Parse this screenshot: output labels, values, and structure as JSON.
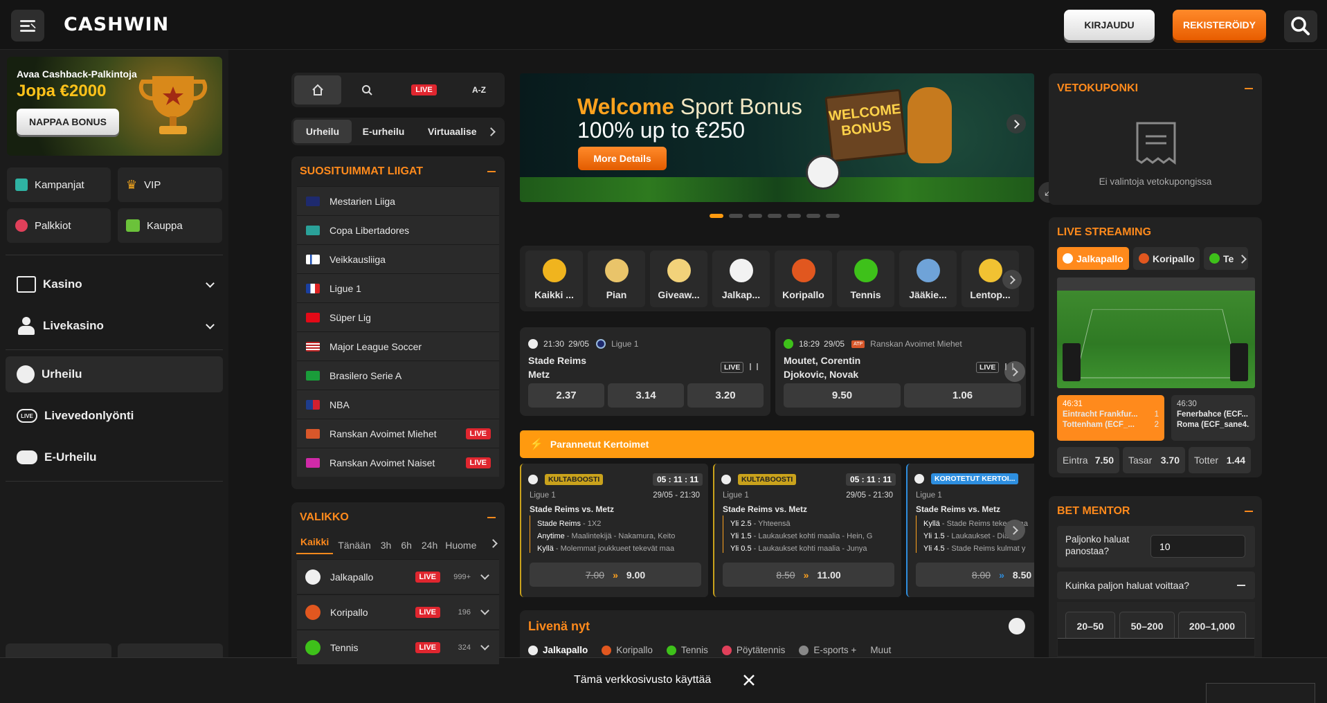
{
  "header": {
    "logo": "CASHWIN",
    "login_label": "KIRJAUDU",
    "register_label": "REKISTERÖIDY"
  },
  "promo": {
    "line1": "Avaa Cashback-Palkintoja",
    "line2": "Jopa €2000",
    "button": "NAPPAA BONUS"
  },
  "left_buttons": [
    {
      "label": "Kampanjat",
      "icon": "gift-icon"
    },
    {
      "label": "VIP",
      "icon": "crown-icon"
    },
    {
      "label": "Palkkiot",
      "icon": "reward-icon"
    },
    {
      "label": "Kauppa",
      "icon": "shop-icon"
    }
  ],
  "left_nav": [
    {
      "label": "Kasino",
      "icon": "slot-machine-icon"
    },
    {
      "label": "Livekasino",
      "icon": "dealer-icon"
    },
    {
      "label": "Urheilu",
      "icon": "soccer-ball-icon"
    },
    {
      "label": "Livevedonlyönti",
      "icon": "live-icon"
    },
    {
      "label": "E-Urheilu",
      "icon": "gamepad-icon"
    }
  ],
  "sport_tabs": {
    "live": "LIVE",
    "az": "A-Z",
    "sub": [
      "Urheilu",
      "E-urheilu",
      "Virtuaalise"
    ]
  },
  "top_leagues": {
    "title": "SUOSITUIMMAT LIIGAT",
    "items": [
      {
        "label": "Mestarien Liiga",
        "live": ""
      },
      {
        "label": "Copa Libertadores",
        "live": ""
      },
      {
        "label": "Veikkausliiga",
        "live": ""
      },
      {
        "label": "Ligue 1",
        "live": ""
      },
      {
        "label": "Süper Lig",
        "live": ""
      },
      {
        "label": "Major League Soccer",
        "live": ""
      },
      {
        "label": "Brasilero Serie A",
        "live": ""
      },
      {
        "label": "NBA",
        "live": ""
      },
      {
        "label": "Ranskan Avoimet Miehet",
        "live": "LIVE"
      },
      {
        "label": "Ranskan Avoimet Naiset",
        "live": "LIVE"
      }
    ]
  },
  "menu": {
    "title": "VALIKKO",
    "filters": [
      "Kaikki",
      "Tänään",
      "3h",
      "6h",
      "24h",
      "Huome"
    ],
    "sports": [
      {
        "label": "Jalkapallo",
        "live": "LIVE",
        "count": "999+"
      },
      {
        "label": "Koripallo",
        "live": "LIVE",
        "count": "196"
      },
      {
        "label": "Tennis",
        "live": "LIVE",
        "count": "324"
      }
    ]
  },
  "banner": {
    "title_a": "Welcome",
    "title_b": " Sport Bonus",
    "subtitle": "100% up to €250",
    "button": "More Details",
    "sign1": "WELCOME",
    "sign2": "BONUS"
  },
  "categories": [
    "Kaikki ...",
    "Pian",
    "Giveaw...",
    "Jalkap...",
    "Koripallo",
    "Tennis",
    "Jääkie...",
    "Lentop..."
  ],
  "events": [
    {
      "time": "21:30",
      "date": "29/05",
      "league": "Ligue 1",
      "team1": "Stade Reims",
      "team2": "Metz",
      "live": "LIVE",
      "odds": [
        "2.37",
        "3.14",
        "3.20"
      ]
    },
    {
      "time": "18:29",
      "date": "29/05",
      "league": "Ranskan Avoimet Miehet",
      "league_badge": "ATP",
      "team1": "Moutet, Corentin",
      "team2": "Djokovic, Novak",
      "live": "LIVE",
      "odds": [
        "9.50",
        "1.06"
      ]
    }
  ],
  "boosted": {
    "title": "Parannetut Kertoimet",
    "cards": [
      {
        "tag": "KULTABOOSTI",
        "timer": "05 : 11 : 11",
        "league": "Ligue 1",
        "datetime": "29/05 - 21:30",
        "match": "Stade Reims vs. Metz",
        "lines": [
          [
            "Stade Reims",
            " - 1X2"
          ],
          [
            "Anytime",
            " - Maalintekijä - Nakamura, Keito"
          ],
          [
            "Kyllä",
            " - Molemmat joukkueet tekevät maa"
          ]
        ],
        "old": "7.00",
        "new": "9.00"
      },
      {
        "tag": "KULTABOOSTI",
        "timer": "05 : 11 : 11",
        "league": "Ligue 1",
        "datetime": "29/05 - 21:30",
        "match": "Stade Reims vs. Metz",
        "lines": [
          [
            "Yli 2.5",
            " - Yhteensä"
          ],
          [
            "Yli 1.5",
            " - Laukaukset kohti maalia - Hein, G"
          ],
          [
            "Yli 0.5",
            " - Laukaukset kohti maalia - Junya"
          ]
        ],
        "old": "8.50",
        "new": "11.00"
      },
      {
        "tag": "KOROTETUT KERTOI...",
        "timer": "",
        "league": "Ligue 1",
        "datetime": "",
        "match": "Stade Reims vs. Metz",
        "lines": [
          [
            "Kyllä",
            " - Stade Reims tekee maa"
          ],
          [
            "Yli 1.5",
            " - Laukaukset - Diakite"
          ],
          [
            "Yli 4.5",
            " - Stade Reims kulmat y"
          ]
        ],
        "old": "8.00",
        "new": "8.50"
      }
    ]
  },
  "live_now": {
    "title": "Livenä nyt",
    "tabs": [
      "Jalkapallo",
      "Koripallo",
      "Tennis",
      "Pöytätennis",
      "E-sports +",
      "Muut"
    ]
  },
  "betslip": {
    "title": "VETOKUPONKI",
    "empty": "Ei valintoja vetokupongissa"
  },
  "streaming": {
    "title": "LIVE STREAMING",
    "tabs": [
      "Jalkapallo",
      "Koripallo",
      "Te"
    ],
    "matches": [
      {
        "time": "46:31",
        "team1": "Eintracht Frankfur...",
        "score1": "1",
        "team2": "Tottenham (ECF_...",
        "score2": "2"
      },
      {
        "time": "46:30",
        "team1": "Fenerbahce (ECF...",
        "score1": "",
        "team2": "Roma (ECF_sane4...",
        "score2": ""
      }
    ],
    "odds": [
      {
        "label": "Eintra",
        "value": "7.50"
      },
      {
        "label": "Tasar",
        "value": "3.70"
      },
      {
        "label": "Totter",
        "value": "1.44"
      }
    ]
  },
  "mentor": {
    "title": "BET MENTOR",
    "stake_q": "Paljonko haluat panostaa?",
    "stake_val": "10",
    "win_q": "Kuinka paljon haluat voittaa?",
    "ranges": [
      "20–50",
      "50–200",
      "200–1,000"
    ]
  },
  "cookie": {
    "text": "Tämä verkkosivusto käyttää"
  }
}
